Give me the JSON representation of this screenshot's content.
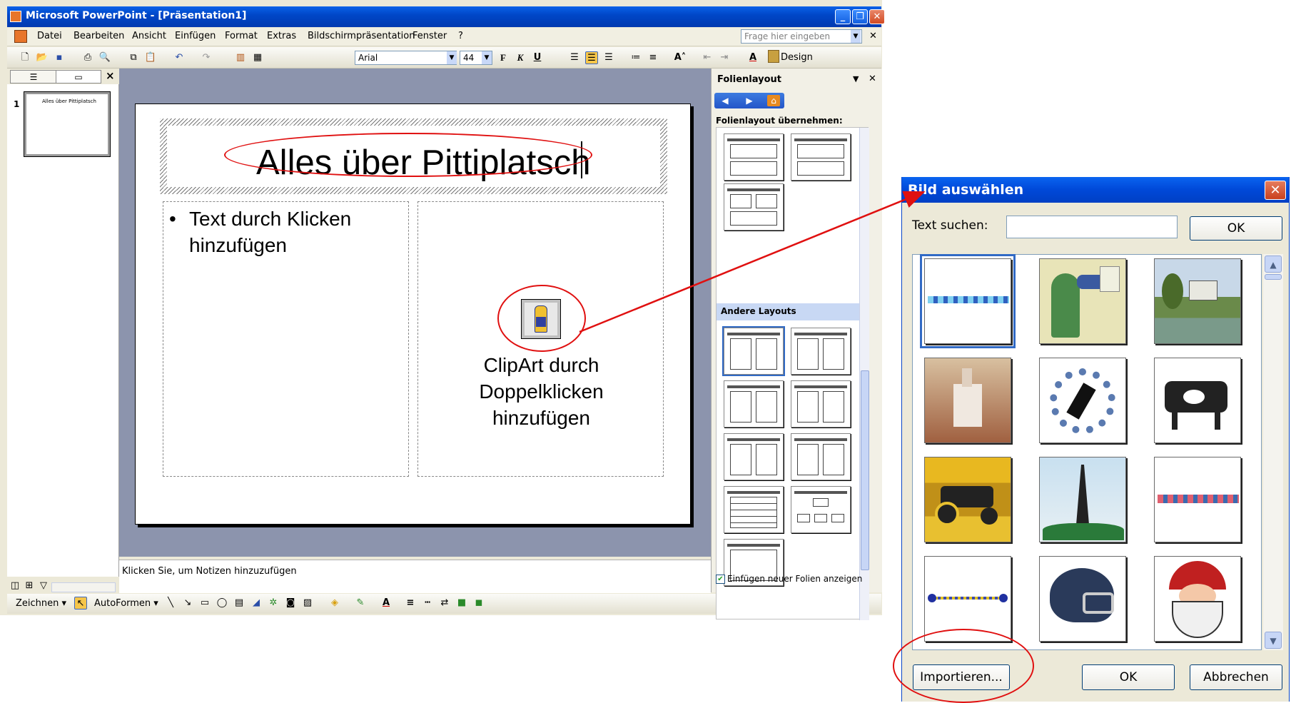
{
  "window": {
    "title": "Microsoft PowerPoint - [Präsentation1]",
    "minimize": "_",
    "restore": "❐",
    "close": "✕"
  },
  "menu": {
    "items": [
      "Datei",
      "Bearbeiten",
      "Ansicht",
      "Einfügen",
      "Format",
      "Extras",
      "Bildschirmpräsentation",
      "Fenster",
      "?"
    ],
    "ask_placeholder": "Frage hier eingeben",
    "close": "✕"
  },
  "toolbar": {
    "font": "Arial",
    "size": "44",
    "bold": "F",
    "italic": "K",
    "underline": "U",
    "fontcolor": "A",
    "design": "Design"
  },
  "left_pane": {
    "slide_number": "1",
    "thumb_title": "Alles über Pittiplatsch",
    "close": "×"
  },
  "slide": {
    "title": "Alles über Pittiplatsch",
    "bullet": "•",
    "left_body_line1": "Text durch Klicken",
    "left_body_line2": "hinzufügen",
    "clipart_line1": "ClipArt durch",
    "clipart_line2": "Doppelklicken",
    "clipart_line3": "hinzufügen"
  },
  "notes": {
    "placeholder": "Klicken Sie, um Notizen hinzuzufügen"
  },
  "drawbar": {
    "draw": "Zeichnen ▾",
    "autoshapes": "AutoFormen ▾"
  },
  "task_pane": {
    "title": "Folienlayout",
    "section_apply": "Folienlayout übernehmen:",
    "section_other": "Andere Layouts",
    "checkbox_label": "Einfügen neuer Folien anzeigen",
    "checkbox_checked": true,
    "close": "✕",
    "menu_arrow": "▼"
  },
  "dialog": {
    "title": "Bild auswählen",
    "search_label": "Text suchen:",
    "search_value": "",
    "search_ok": "OK",
    "import_button": "Importieren...",
    "ok_button": "OK",
    "cancel_button": "Abbrechen",
    "close": "✕",
    "clipart_items": [
      "border-dots",
      "optician",
      "country-house",
      "church-painting",
      "gears-runner",
      "cow",
      "tractor",
      "eiffel-tower",
      "border-pattern",
      "border-beads",
      "football-helmet",
      "santa-claus"
    ]
  },
  "colors": {
    "xp_blue": "#0a62e8",
    "annotation_red": "#e01010",
    "selection_blue": "#316ac5"
  }
}
